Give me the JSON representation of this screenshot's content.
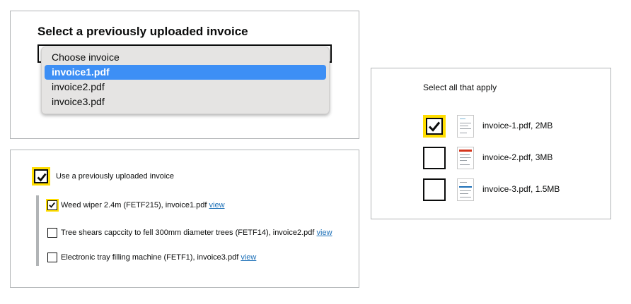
{
  "dropdown_panel": {
    "heading": "Select a previously uploaded invoice",
    "options": [
      "Choose invoice",
      "invoice1.pdf",
      "invoice2.pdf",
      "invoice3.pdf"
    ],
    "selected_option": "invoice1.pdf"
  },
  "nested_panel": {
    "parent_label": "Use a previously uploaded invoice",
    "parent_checked": true,
    "items": [
      {
        "label": "Weed wiper 2.4m (FETF215), invoice1.pdf",
        "link": "view",
        "checked": true
      },
      {
        "label": "Tree shears capccity to fell 300mm diameter trees (FETF14), invoice2.pdf",
        "link": "view",
        "checked": false
      },
      {
        "label": "Electronic tray filling machine (FETF1), invoice3.pdf",
        "link": "view",
        "checked": false
      }
    ]
  },
  "file_panel": {
    "hint": "Select all that apply",
    "files": [
      {
        "name": "invoice-1.pdf, 2MB",
        "checked": true
      },
      {
        "name": "invoice-2.pdf, 3MB",
        "checked": false
      },
      {
        "name": "invoice-3.pdf, 1.5MB",
        "checked": false
      }
    ]
  },
  "colors": {
    "focus": "#ffdd00",
    "link": "#1d70b8",
    "selected_option": "#3d8ff5",
    "border": "#b1b4b6"
  },
  "icons": [
    "check-icon",
    "pdf-thumbnail-icon"
  ]
}
